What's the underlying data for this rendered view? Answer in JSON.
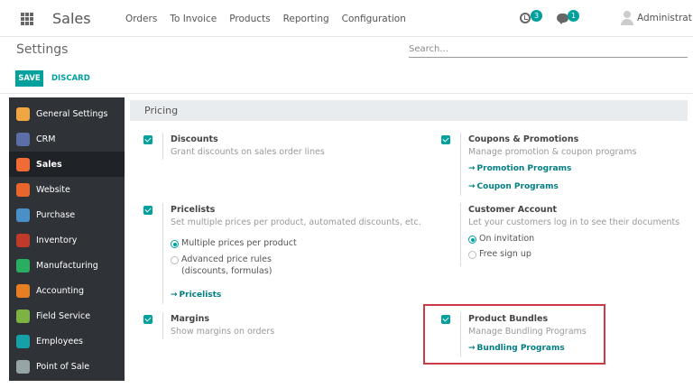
{
  "navbar": {
    "app_name": "Sales",
    "menu": [
      "Orders",
      "To Invoice",
      "Products",
      "Reporting",
      "Configuration"
    ],
    "activity_count": "3",
    "messages_count": "1",
    "user_name": "Administrat"
  },
  "control_panel": {
    "title": "Settings",
    "search_placeholder": "Search...",
    "save_label": "SAVE",
    "discard_label": "DISCARD"
  },
  "sidebar": {
    "items": [
      {
        "label": "General Settings",
        "icon": "gear-icon",
        "color": "#f0a742"
      },
      {
        "label": "CRM",
        "icon": "handshake-icon",
        "color": "#5b6ea8"
      },
      {
        "label": "Sales",
        "icon": "chart-icon",
        "color": "#f06b35"
      },
      {
        "label": "Website",
        "icon": "globe-icon",
        "color": "#e8652c"
      },
      {
        "label": "Purchase",
        "icon": "card-icon",
        "color": "#4a90c8"
      },
      {
        "label": "Inventory",
        "icon": "boxes-icon",
        "color": "#c0392b"
      },
      {
        "label": "Manufacturing",
        "icon": "wrench-icon",
        "color": "#27ae60"
      },
      {
        "label": "Accounting",
        "icon": "document-icon",
        "color": "#e67e22"
      },
      {
        "label": "Field Service",
        "icon": "map-icon",
        "color": "#7cb342"
      },
      {
        "label": "Employees",
        "icon": "people-icon",
        "color": "#16a0a8"
      },
      {
        "label": "Point of Sale",
        "icon": "register-icon",
        "color": "#95a5a6"
      }
    ]
  },
  "section": {
    "title": "Pricing",
    "discounts": {
      "title": "Discounts",
      "desc": "Grant discounts on sales order lines"
    },
    "coupons": {
      "title": "Coupons & Promotions",
      "desc": "Manage promotion & coupon programs",
      "link1": "Promotion Programs",
      "link2": "Coupon Programs"
    },
    "pricelists": {
      "title": "Pricelists",
      "desc": "Set multiple prices per product, automated discounts, etc.",
      "opt1": "Multiple prices per product",
      "opt2_line1": "Advanced price rules",
      "opt2_line2": "(discounts, formulas)",
      "link": "Pricelists"
    },
    "customer_account": {
      "title": "Customer Account",
      "desc": "Let your customers log in to see their documents",
      "opt1": "On invitation",
      "opt2": "Free sign up"
    },
    "margins": {
      "title": "Margins",
      "desc": "Show margins on orders"
    },
    "bundles": {
      "title": "Product Bundles",
      "desc": "Manage Bundling Programs",
      "link": "Bundling Programs"
    }
  },
  "colors": {
    "accent": "#00a09d",
    "link": "#017e84",
    "sidebar_bg": "#2f3338",
    "highlight": "#cc3b45"
  }
}
